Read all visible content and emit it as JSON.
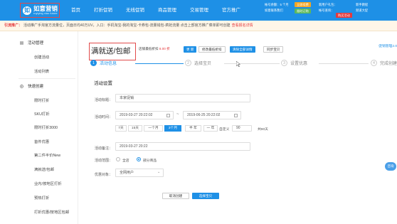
{
  "header": {
    "logo_title": "如意营销",
    "logo_sub": "ruyiying xiao future",
    "nav": [
      "首页",
      "打折促销",
      "无线促销",
      "商品管理",
      "交易管理",
      "官方推广"
    ],
    "right_line1": "帐号余额：5 个月",
    "right_btn1": "立即续费",
    "right_line2": "如意联系我们",
    "right_btn2": "限时订购",
    "right_line3": "新用户礼包：",
    "right_line4": "帐号查询：",
    "right_btn3": "购买活动",
    "right_col2a": "新手教程",
    "right_col2b": "频道大促"
  },
  "notice": {
    "label": "引流推广：",
    "text": "活动推广手淘官方流量位，页面日均40万UV，入口：手机淘宝-我的淘宝-卡券包-流量钱包-疯抢流量 点击上部官方推广菜单即可创建",
    "link": "查看报名详情"
  },
  "sidebar": {
    "group1": "活动管理",
    "g1_items": [
      "创建活动",
      "活动列表"
    ],
    "group2": "快速创建",
    "g2_items": [
      "限时打折",
      "SKU打折",
      "限时打折3000",
      "首件优惠",
      "第二件半价New",
      "满就送/包邮",
      "业内/按地区打折",
      "预热打折",
      "打折优惠/按地区包邮"
    ]
  },
  "main": {
    "title": "满就送/包邮",
    "discount_prefix": "店铺最低折扣",
    "discount_value": "8.00 折",
    "btn_update": "更 新",
    "btn_modify": "修改最低折扣",
    "btn_clear": "清除全部详情",
    "btn_sync": "同步宝贝",
    "right_link": "促销管理2.0",
    "steps": [
      {
        "num": "1",
        "label": "活动信息"
      },
      {
        "num": "2",
        "label": "选择宝贝"
      },
      {
        "num": "3",
        "label": "设置优惠"
      },
      {
        "num": "4",
        "label": "完成创建"
      }
    ],
    "section_title": "活动设置",
    "label_name": "活动标题：",
    "value_name": "本家促销",
    "label_time": "活动时间：",
    "start_time": "2019-03-27 20:22:02",
    "end_time": "2019-06-25 20:22:02",
    "tilde": "~",
    "quick_options": [
      "7天",
      "15天",
      "一个月",
      "3个月",
      "半 年",
      "一 年"
    ],
    "custom_label": "自定义",
    "custom_value": "90",
    "total_days": "共90天",
    "label_remark": "活动备注：",
    "value_remark": "2019-03-27 20:22",
    "label_scope": "活动范围：",
    "scope_all": "全店",
    "scope_part": "部分商品",
    "label_target": "优惠对象：",
    "target_value": "全网用户",
    "btn_cancel": "取消创建",
    "btn_next": "选择宝贝"
  },
  "float_help": "咨询",
  "colors": {
    "primary": "#1e90e6",
    "accent_red": "#e4393c",
    "notice_bg": "#fff6e8",
    "highlight_box": "#e14b4b"
  },
  "icons": [
    "logo-mark-icon",
    "calendar-icon",
    "chevron-down-icon",
    "cursor-icon",
    "list-icon",
    "bolt-icon"
  ]
}
